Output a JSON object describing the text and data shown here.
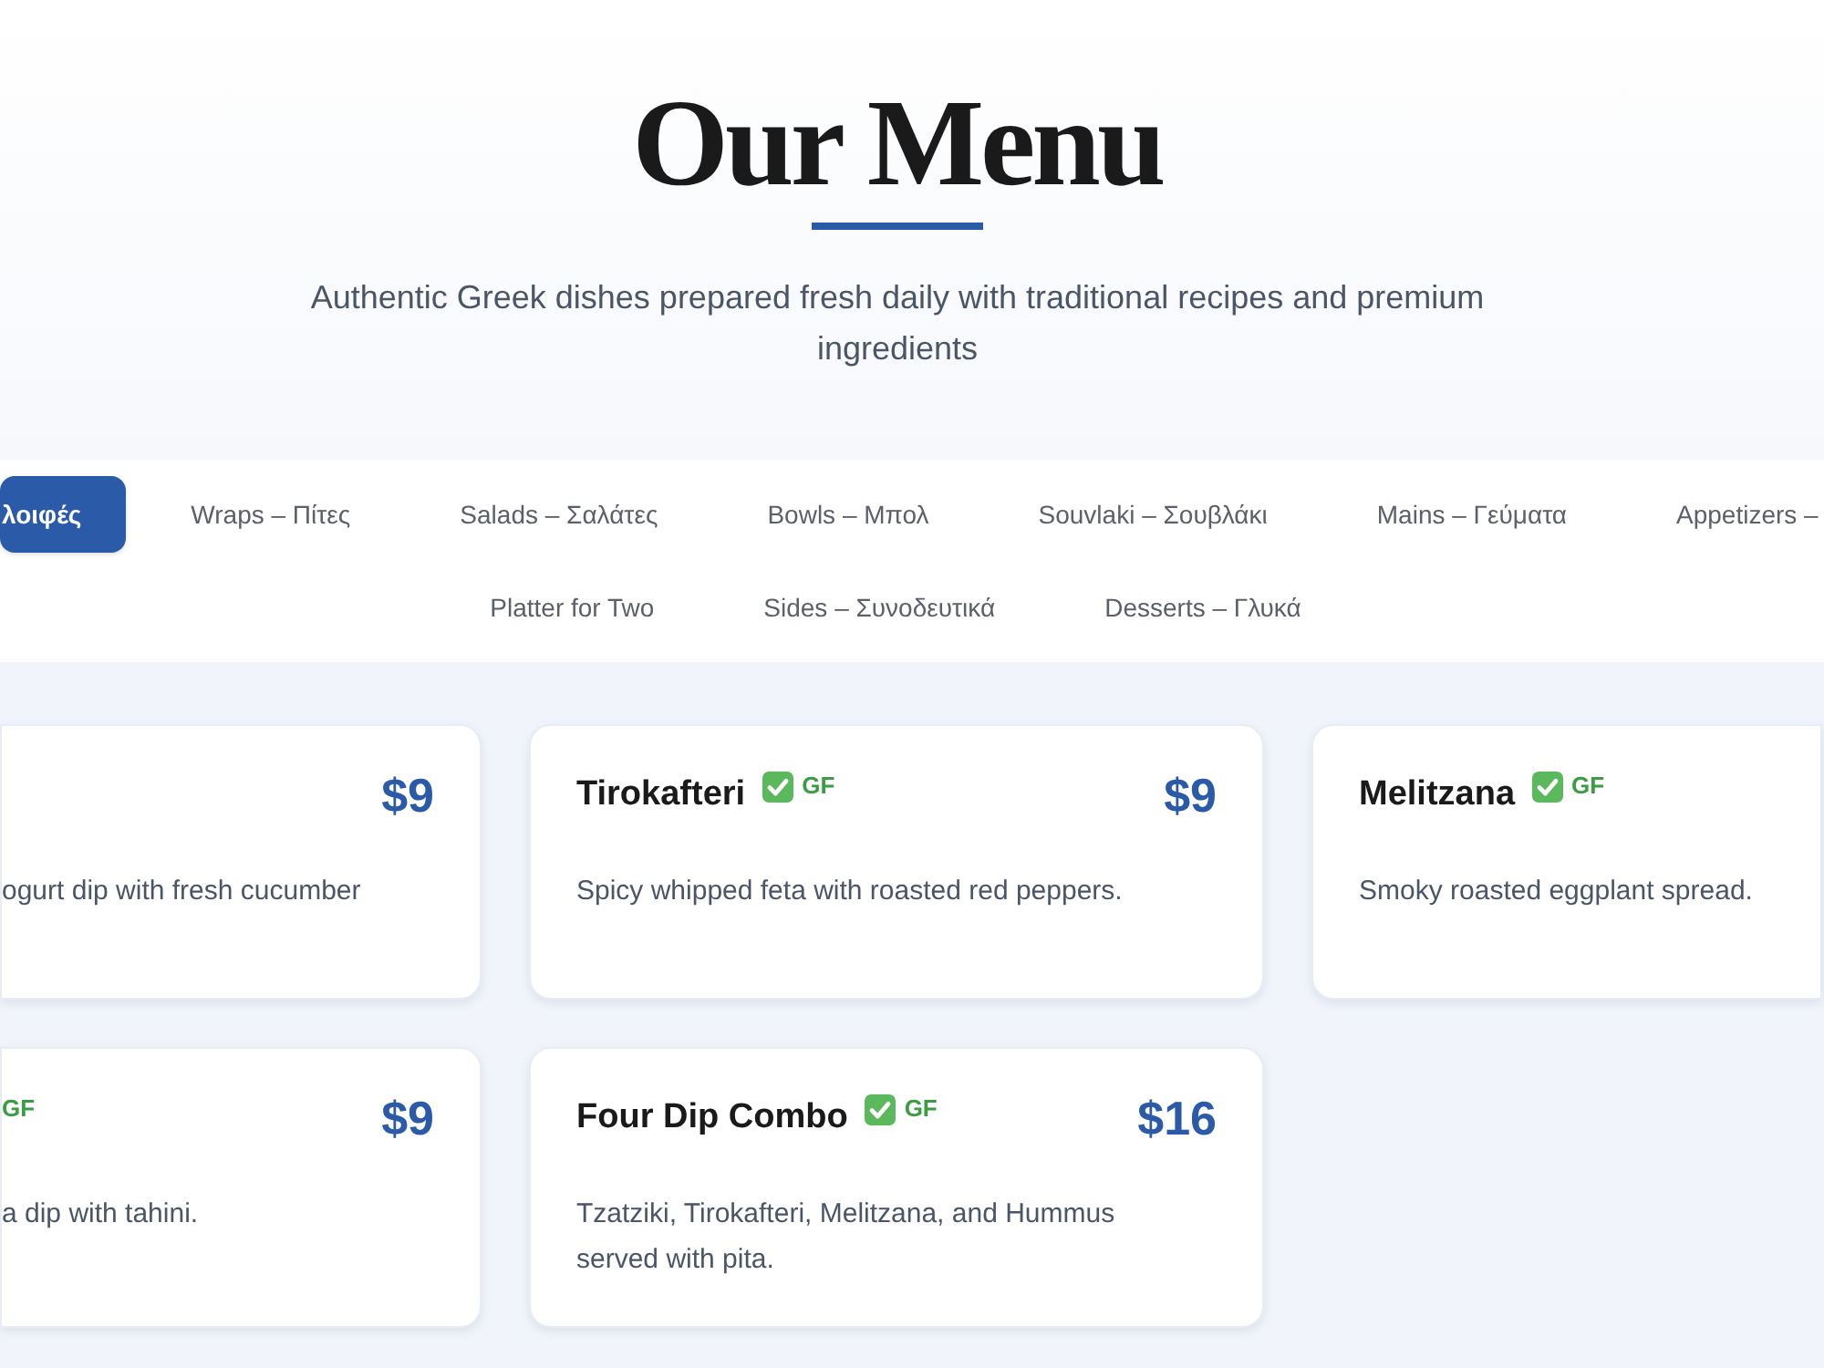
{
  "header": {
    "title": "Our Menu",
    "subtitle": "Authentic Greek dishes prepared fresh daily with traditional recipes and premium ingredients"
  },
  "tabs": [
    {
      "label": "λοιφές",
      "selected": true
    },
    {
      "label": "Wraps – Πίτες",
      "selected": false
    },
    {
      "label": "Salads – Σαλάτες",
      "selected": false
    },
    {
      "label": "Bowls – Μπολ",
      "selected": false
    },
    {
      "label": "Souvlaki – Σουβλάκι",
      "selected": false
    },
    {
      "label": "Mains – Γεύματα",
      "selected": false
    },
    {
      "label": "Appetizers –",
      "selected": false
    },
    {
      "label": "Platter for Two",
      "selected": false
    },
    {
      "label": "Sides – Συνοδευτικά",
      "selected": false
    },
    {
      "label": "Desserts – Γλυκά",
      "selected": false
    }
  ],
  "cards": [
    {
      "check": false,
      "price": "$9",
      "description": "ogurt dip with fresh cucumber"
    },
    {
      "title": "Tirokafteri",
      "check": true,
      "badge": "GF",
      "price": "$9",
      "description": "Spicy whipped feta with roasted red peppers."
    },
    {
      "title": "Melitzana",
      "check": true,
      "badge": "GF",
      "description": "Smoky roasted eggplant spread."
    },
    {
      "check": false,
      "badge": "GF",
      "price": "$9",
      "description": "a dip with tahini."
    },
    {
      "title": "Four Dip Combo",
      "check": true,
      "badge": "GF",
      "price": "$16",
      "description": "Tzatziki, Tirokafteri, Melitzana, and Hummus served with pita."
    }
  ]
}
